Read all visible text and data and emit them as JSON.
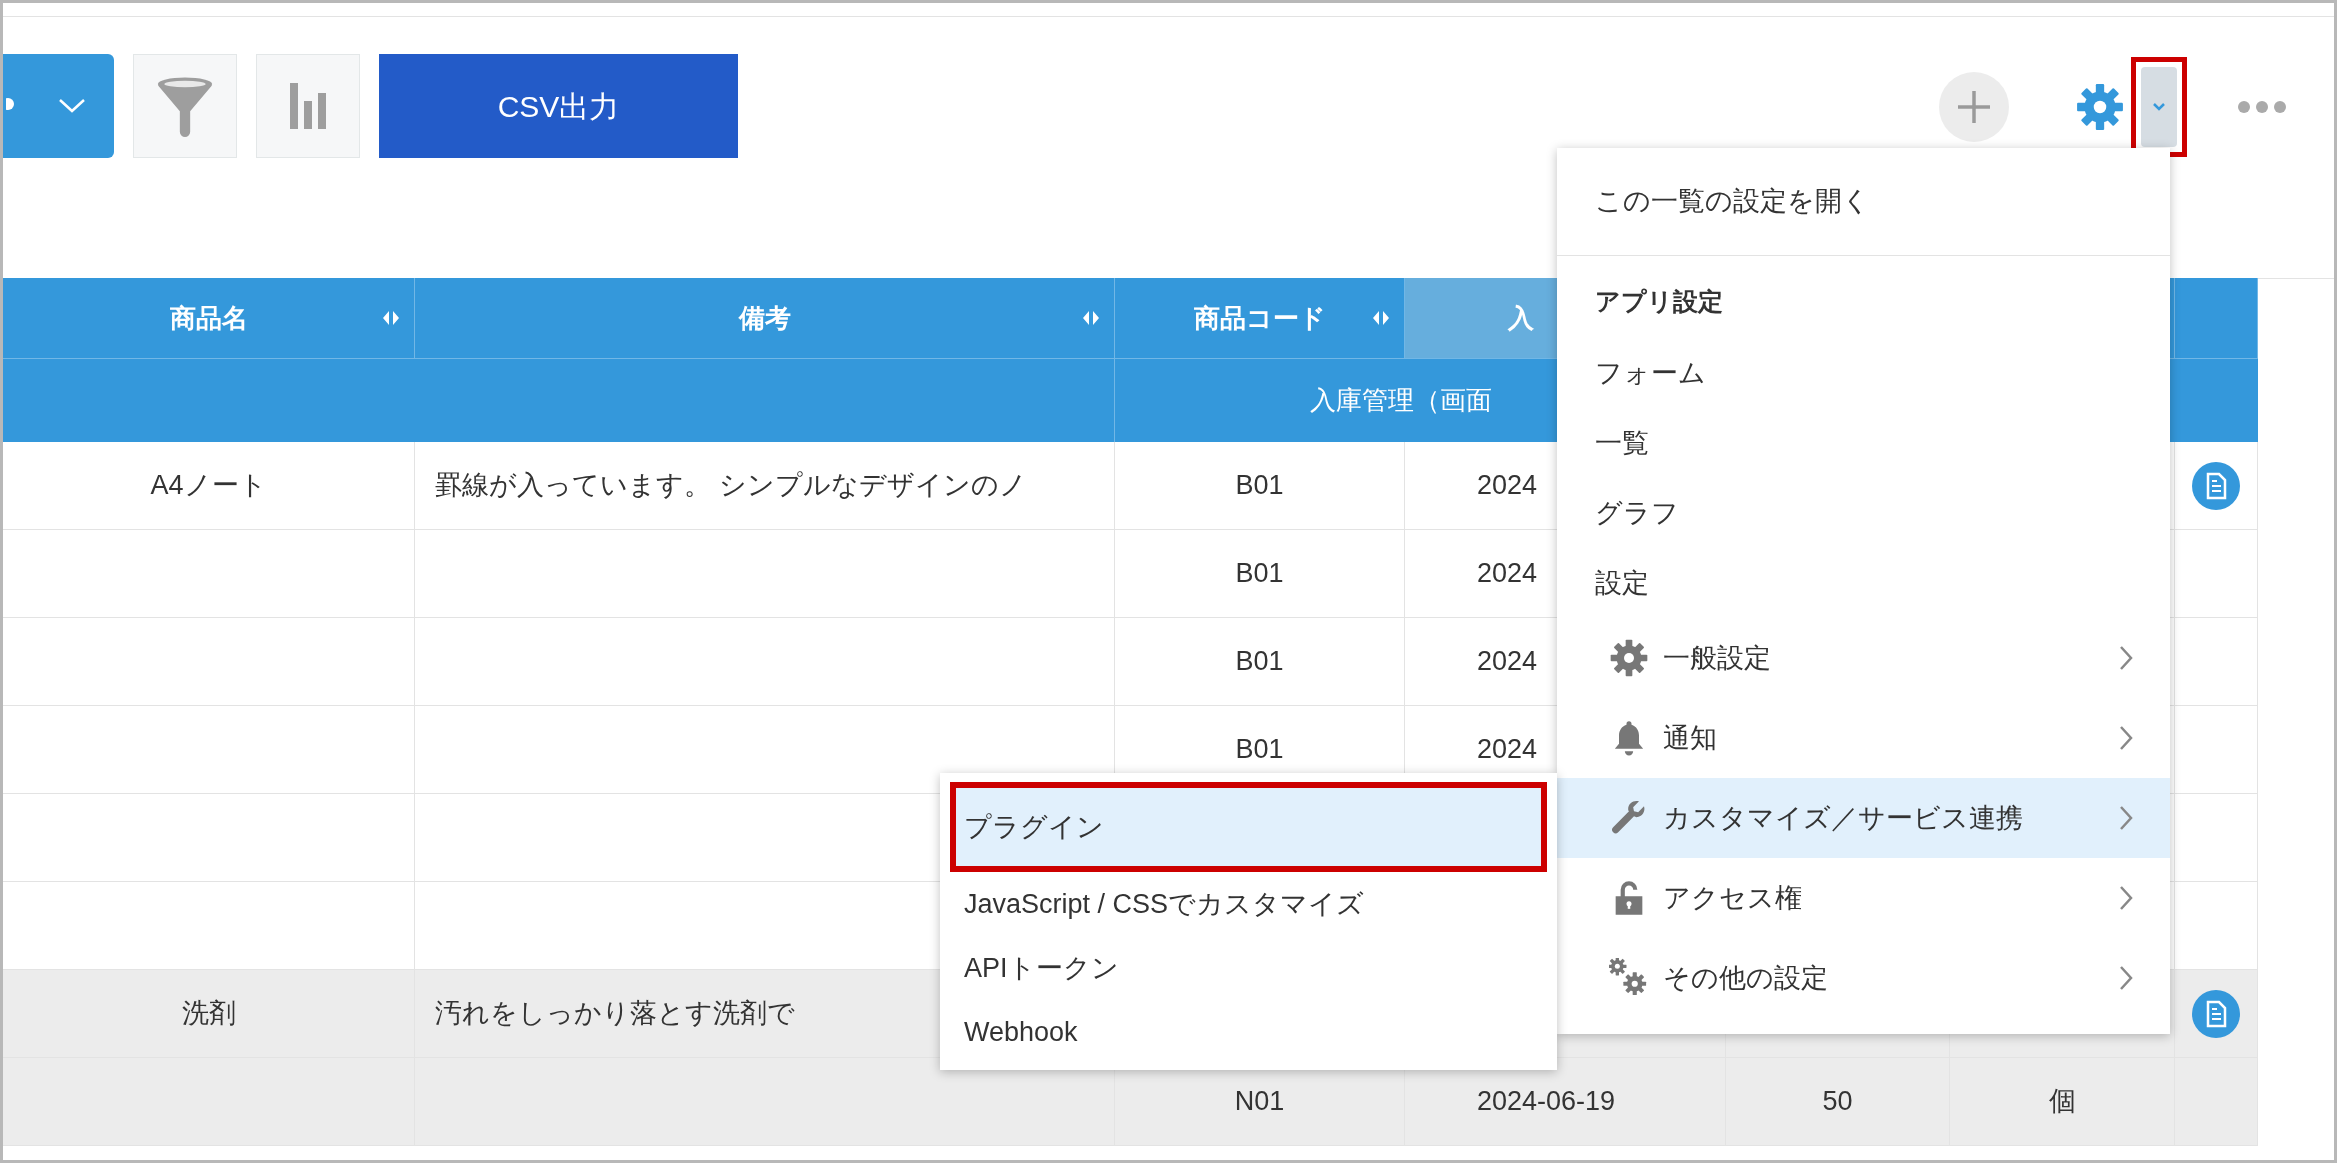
{
  "toolbar": {
    "buttons": [
      {
        "kind": "view_menu"
      },
      {
        "kind": "filter"
      },
      {
        "kind": "graph"
      },
      {
        "kind": "primary",
        "label": "CSV出力"
      }
    ],
    "actions": [
      {
        "kind": "add"
      },
      {
        "kind": "settings"
      },
      {
        "kind": "settings_dropdown",
        "annotated": true
      },
      {
        "kind": "more"
      }
    ]
  },
  "table": {
    "columns": [
      {
        "label": "商品名",
        "resizable": true,
        "highlighted": false
      },
      {
        "label": "備考",
        "resizable": true,
        "highlighted": false
      },
      {
        "label": "商品コード",
        "resizable": true,
        "highlighted": false
      },
      {
        "label": "入",
        "resizable": false,
        "highlighted": true
      }
    ],
    "group_header": "入庫管理（画面",
    "rows": [
      {
        "cells": {
          "product_name": "A4ノート",
          "note": "罫線が入っています。 シンプルなデザインのノ",
          "product_code": "B01",
          "date": "2024"
        },
        "shaded": false,
        "detail_icon": true
      },
      {
        "cells": {
          "product_code": "B01",
          "date": "2024"
        },
        "shaded": false,
        "detail_icon": false
      },
      {
        "cells": {
          "product_code": "B01",
          "date": "2024"
        },
        "shaded": false,
        "detail_icon": false
      },
      {
        "cells": {
          "product_code": "B01",
          "date": "2024"
        },
        "shaded": false,
        "detail_icon": false
      },
      {
        "cells": {},
        "shaded": false,
        "detail_icon": false
      },
      {
        "cells": {},
        "shaded": false,
        "detail_icon": false
      },
      {
        "cells": {
          "product_name": "洗剤",
          "note": "汚れをしっかり落とす洗剤で"
        },
        "shaded": true,
        "detail_icon": true
      },
      {
        "cells": {
          "product_code": "N01",
          "date": "2024-06-19",
          "column_5": "50",
          "column_6": "個"
        },
        "shaded": true,
        "detail_icon": false
      }
    ]
  },
  "settings_menu": {
    "items": [
      {
        "kind": "action",
        "label": "この一覧の設定を開く"
      },
      {
        "kind": "divider"
      },
      {
        "kind": "heading",
        "label": "アプリ設定"
      },
      {
        "kind": "action",
        "label": "フォーム"
      },
      {
        "kind": "action",
        "label": "一覧"
      },
      {
        "kind": "action",
        "label": "グラフ"
      },
      {
        "kind": "action",
        "label": "設定"
      },
      {
        "kind": "submenu",
        "label": "一般設定",
        "selected": false
      },
      {
        "kind": "submenu",
        "label": "通知",
        "selected": false
      },
      {
        "kind": "submenu",
        "label": "カスタマイズ／サービス連携",
        "selected": true
      },
      {
        "kind": "submenu",
        "label": "アクセス権",
        "selected": false
      },
      {
        "kind": "submenu",
        "label": "その他の設定",
        "selected": false
      }
    ]
  },
  "submenu": {
    "items": [
      {
        "label": "プラグイン",
        "selected": true,
        "annotated": true
      },
      {
        "label": "JavaScript / CSSでカスタマイズ",
        "selected": false,
        "annotated": false
      },
      {
        "label": "APIトークン",
        "selected": false,
        "annotated": false
      },
      {
        "label": "Webhook",
        "selected": false,
        "annotated": false
      }
    ]
  }
}
